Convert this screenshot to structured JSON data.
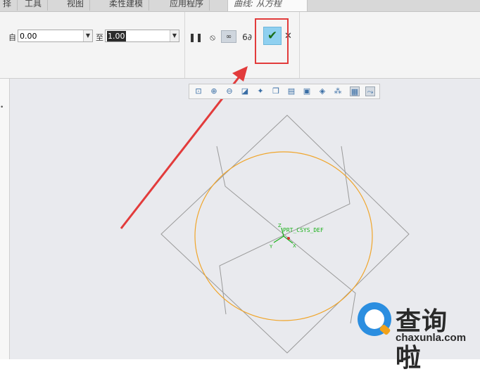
{
  "tabs": [
    {
      "label": "择"
    },
    {
      "label": "工具"
    },
    {
      "label": "视图"
    },
    {
      "label": "柔性建模"
    },
    {
      "label": "应用程序"
    },
    {
      "label": "曲线: 从方程",
      "active": true
    }
  ],
  "ribbon": {
    "from_label": "自",
    "from_value": "0.00",
    "to_label": "至",
    "to_value": "1.00",
    "pause_icon": "pause-icon",
    "stop_icon": "no-entry-icon",
    "preview_icon": "verify-icon",
    "glasses_icon": "glasses-icon",
    "ok_icon": "checkmark-icon",
    "cancel_icon": "close-icon"
  },
  "view_toolbar": {
    "icons": [
      "refit-icon",
      "zoom-in-icon",
      "zoom-out-icon",
      "repaint-icon",
      "view-manager-icon",
      "saved-orientations-icon",
      "named-views-icon",
      "display-style-icon",
      "perspective-icon",
      "datum-display-icon",
      "spin-center-icon",
      "annotation-display-icon"
    ]
  },
  "graphics": {
    "csys_label": "PRT_CSYS_DEF",
    "axis_z": "Z",
    "axis_y": "Y",
    "axis_x": "X",
    "curve_color": "#f0a52a",
    "plane_color": "#9a9a9a",
    "csys_color": "#19b019"
  },
  "annotation": {
    "box_color": "#e23b3b",
    "arrow_color": "#e23b3b"
  },
  "watermark": {
    "cn": "查询啦",
    "en": "chaxunla.com"
  },
  "left_panel": {
    "mark": "•"
  }
}
